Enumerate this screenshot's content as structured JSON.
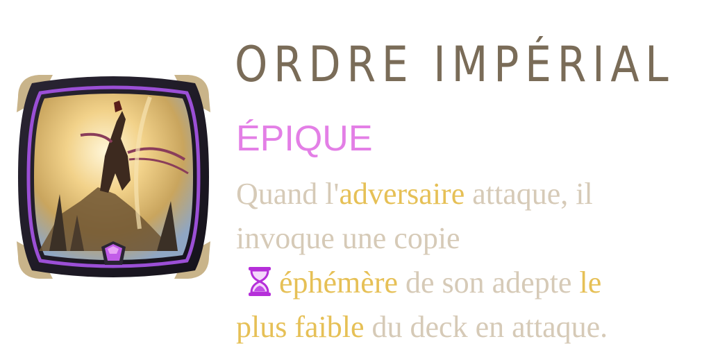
{
  "card": {
    "title": "ORDRE IMPÉRIAL",
    "rarity": "ÉPIQUE",
    "colors": {
      "title": "#7a6c58",
      "rarity": "#e37fe6",
      "text": "#d6cab7",
      "keyword": "#e6c056",
      "frame_accent": "#9b4fd6"
    },
    "art_icon": "warrior-portrait-icon",
    "description": {
      "line1_a": "Quand l'",
      "kw_adversaire": "adversaire",
      "line1_b": " attaque, il",
      "line2": "invoque une copie",
      "ephemeral_icon": "hourglass-icon",
      "kw_ephemere": "éphémère",
      "line3_b": " de son adepte ",
      "kw_le": "le",
      "kw_plus_faible": "plus faible",
      "line4_b": " du deck en attaque."
    }
  }
}
